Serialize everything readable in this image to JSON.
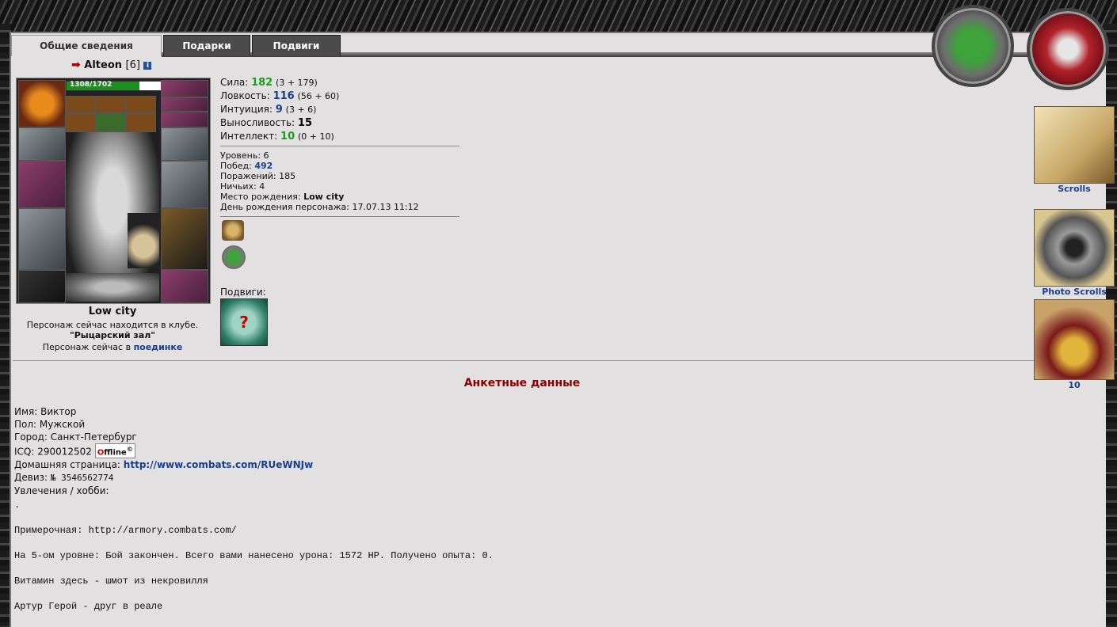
{
  "tabs": [
    {
      "label": "Общие сведения",
      "active": true
    },
    {
      "label": "Подарки",
      "active": false
    },
    {
      "label": "Подвиги",
      "active": false
    }
  ],
  "character": {
    "name": "Alteon",
    "level": "[6]",
    "hp": "1308/1702",
    "hp_fraction": 0.768,
    "location": "Low city",
    "club_text": "Персонаж сейчас находится в клубе.",
    "club_name": "\"Рыцарский зал\"",
    "duel_prefix": "Персонаж сейчас в",
    "duel_link": "поединке"
  },
  "stats": [
    {
      "label": "Сила:",
      "value": "182",
      "detail": "(3 + 179)",
      "color": "green"
    },
    {
      "label": "Ловкость:",
      "value": "116",
      "detail": "(56 + 60)",
      "color": "blue"
    },
    {
      "label": "Интуиция:",
      "value": "9",
      "detail": "(3 + 6)",
      "color": "blue"
    },
    {
      "label": "Выносливость:",
      "value": "15",
      "detail": "",
      "color": "dark"
    },
    {
      "label": "Интеллект:",
      "value": "10",
      "detail": "(0 + 10)",
      "color": "green"
    }
  ],
  "info": {
    "level_label": "Уровень:",
    "level_value": "6",
    "wins_label": "Побед:",
    "wins_value": "492",
    "losses_label": "Поражений:",
    "losses_value": "185",
    "draws_label": "Ничьих:",
    "draws_value": "4",
    "birthplace_label": "Место рождения:",
    "birthplace_value": "Low city",
    "birthday_label": "День рождения персонажа:",
    "birthday_value": "17.07.13 11:12"
  },
  "podvigi_label": "Подвиги:",
  "anketa": {
    "title": "Анкетные данные",
    "name": "Имя: Виктор",
    "gender": "Пол: Мужской",
    "city": "Город: Санкт-Петербург",
    "icq_label": "ICQ: 290012502",
    "icq_status": "ffline",
    "icq_status_prefix": "O",
    "homepage_label": "Домашняя страница:",
    "homepage_url": "http://www.combats.com/RUeWNJw",
    "motto_label": "Девиз:",
    "motto_value": "№ 3546562774",
    "hobby_label": "Увлечения / хобби:",
    "hobby_text": ".\n\nПримерочная: http://armory.combats.com/\n\nНа 5-ом уровне: Бой закончен. Всего вами нанесено урона: 1572 HP. Получено опыта: 0.\n\nВитамин здесь - шмот из некровилля\n\nАртур Герой - друг в реале"
  },
  "side": {
    "scrolls_label": "Scrolls",
    "photo_label": "Photo Scrolls",
    "book_label": "10"
  }
}
